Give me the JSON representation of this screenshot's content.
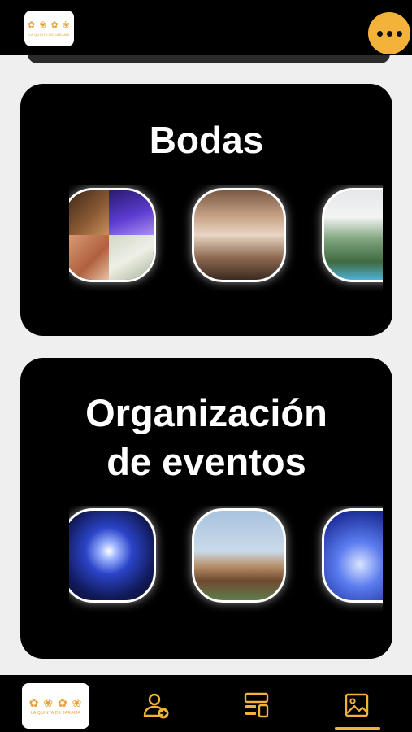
{
  "brand": {
    "logo_glyphs": "✿ ❀ ✿ ❀",
    "logo_text": "LA QUINTA DE JARAMA"
  },
  "header": {
    "menu_icon": "more-horizontal-icon"
  },
  "sections": [
    {
      "title": "Bodas"
    },
    {
      "title_line1": "Organización",
      "title_line2": "de eventos"
    }
  ],
  "bottom_nav": {
    "items": [
      "home-logo",
      "profile-arrow-icon",
      "layout-icon",
      "gallery-icon"
    ],
    "active_index": 3
  },
  "colors": {
    "accent": "#F3B23A",
    "card_bg": "#000000",
    "page_bg": "#EFEFEF"
  }
}
